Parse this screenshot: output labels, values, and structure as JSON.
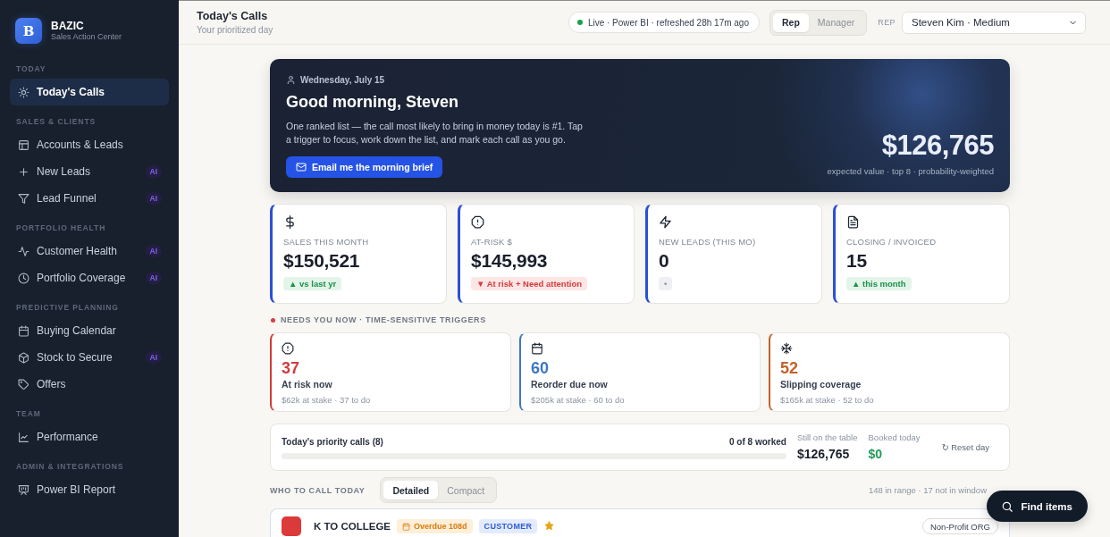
{
  "sidebar": {
    "brand": {
      "logo": "B",
      "name": "BAZIC",
      "tagline": "Sales Action Center"
    },
    "sections": [
      {
        "label": "TODAY",
        "items": [
          {
            "label": "Today's Calls",
            "selected": true
          }
        ]
      },
      {
        "label": "SALES & CLIENTS",
        "items": [
          {
            "label": "Accounts & Leads",
            "selected": false
          },
          {
            "label": "New Leads",
            "selected": false,
            "badge": "AI"
          },
          {
            "label": "Lead Funnel",
            "selected": false,
            "badge": "AI"
          }
        ]
      },
      {
        "label": "PORTFOLIO HEALTH",
        "items": [
          {
            "label": "Customer Health",
            "selected": false,
            "badge": "AI"
          },
          {
            "label": "Portfolio Coverage",
            "selected": false,
            "badge": "AI"
          }
        ]
      },
      {
        "label": "PREDICTIVE PLANNING",
        "items": [
          {
            "label": "Buying Calendar",
            "selected": false
          },
          {
            "label": "Stock to Secure",
            "selected": false,
            "badge": "AI"
          },
          {
            "label": "Offers",
            "selected": false
          }
        ]
      },
      {
        "label": "TEAM",
        "items": [
          {
            "label": "Performance",
            "selected": false
          }
        ]
      },
      {
        "label": "ADMIN & INTEGRATIONS",
        "items": [
          {
            "label": "Power BI Report",
            "selected": false
          }
        ]
      }
    ]
  },
  "header": {
    "title": "Today's Calls",
    "subtitle": "Your prioritized day",
    "status": {
      "text": "Live · Power BI · refreshed 28h 17m ago",
      "live": true
    },
    "view_toggle": [
      {
        "label": "Rep",
        "selected": true
      },
      {
        "label": "Manager",
        "selected": false
      }
    ],
    "rep_label": "REP",
    "rep_select": {
      "value": "Steven Kim · Medium"
    }
  },
  "hero": {
    "date": "Wednesday, July 15",
    "greeting": "Good morning, Steven",
    "description": "One ranked list — the call most likely to bring in money today is #1. Tap a trigger to focus, work down the list, and mark each call as you go.",
    "button": "Email me the morning brief",
    "total": "$126,765",
    "total_caption": "expected value · top 8 · probability-weighted"
  },
  "kpis": [
    {
      "label": "SALES THIS MONTH",
      "value": "$150,521",
      "trend": "▲ vs last yr",
      "kind": "positive"
    },
    {
      "label": "AT-RISK $",
      "value": "$145,993",
      "trend": "▼ At risk + Need attention",
      "kind": "negative"
    },
    {
      "label": "NEW LEADS (THIS MO)",
      "value": "0",
      "trend": "•",
      "kind": "neutral"
    },
    {
      "label": "CLOSING / INVOICED",
      "value": "15",
      "trend": "▲ this month",
      "kind": "positive"
    }
  ],
  "triggers": {
    "label": "NEEDS YOU NOW · TIME-SENSITIVE TRIGGERS",
    "cards": [
      {
        "count": "37",
        "label": "At risk now",
        "detail": "$62k at stake · 37 to do",
        "color": "#d13b3b"
      },
      {
        "count": "60",
        "label": "Reorder due now",
        "detail": "$205k at stake · 60 to do",
        "color": "#3b78c2"
      },
      {
        "count": "52",
        "label": "Slipping coverage",
        "detail": "$165k at stake · 52 to do",
        "color": "#c4612a"
      }
    ]
  },
  "progress": {
    "title": "Today's priority calls (8)",
    "worked": "0 of 8 worked",
    "level": 0,
    "stats": [
      {
        "label": "Still on the table",
        "value": "$126,765",
        "kind": "neutral"
      },
      {
        "label": "Booked today",
        "value": "$0",
        "kind": "positive"
      }
    ],
    "reset": "↻ Reset day"
  },
  "call_list": {
    "label": "WHO TO CALL TODAY",
    "view_modes": [
      {
        "label": "Detailed",
        "selected": true
      },
      {
        "label": "Compact",
        "selected": false
      }
    ],
    "summary": "148 in range · 17 not in window",
    "rows": [
      {
        "name": "K TO COLLEGE",
        "tags": [
          {
            "label": "Overdue 108d",
            "kind": "overdue"
          },
          {
            "label": "CUSTOMER",
            "kind": "type"
          }
        ],
        "starred": true,
        "segment": "Non-Profit ORG"
      }
    ]
  },
  "find_button": {
    "label": "Find items"
  }
}
